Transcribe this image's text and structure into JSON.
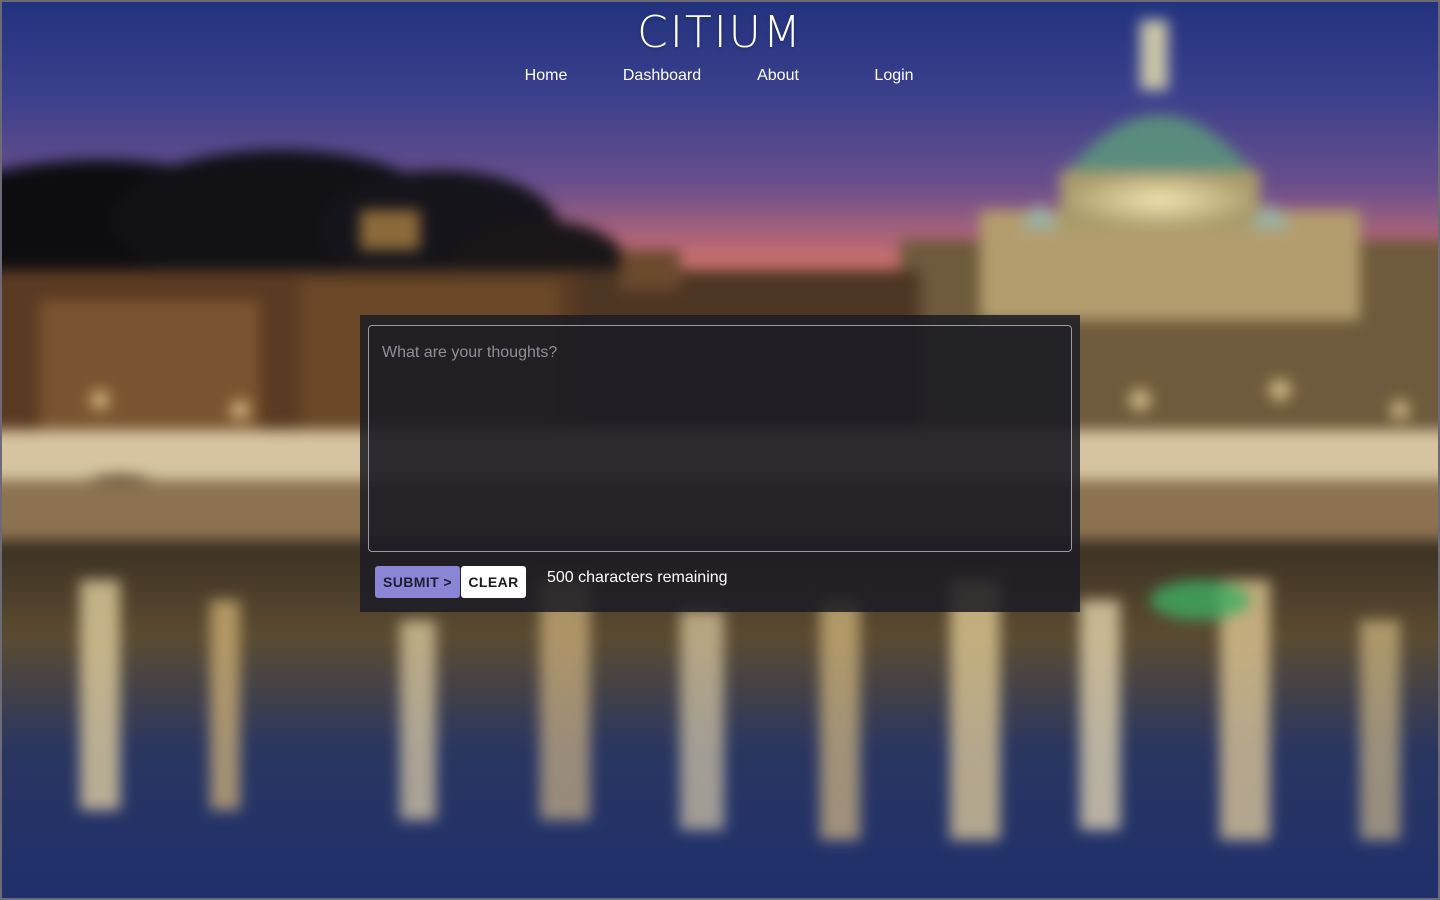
{
  "site": {
    "title": "CITIUM"
  },
  "nav": {
    "items": [
      {
        "label": "Home"
      },
      {
        "label": "Dashboard"
      },
      {
        "label": "About"
      },
      {
        "label": "Login"
      }
    ]
  },
  "composer": {
    "placeholder": "What are your thoughts?",
    "value": "",
    "submit_label": "SUBMIT >",
    "clear_label": "CLEAR",
    "char_count_text": "500 characters remaining"
  },
  "colors": {
    "submit_button": "#8b85d6",
    "clear_button": "#ffffff",
    "panel": "#1c1c24"
  },
  "background": {
    "icon": "blurred-rome-dusk-photo"
  }
}
